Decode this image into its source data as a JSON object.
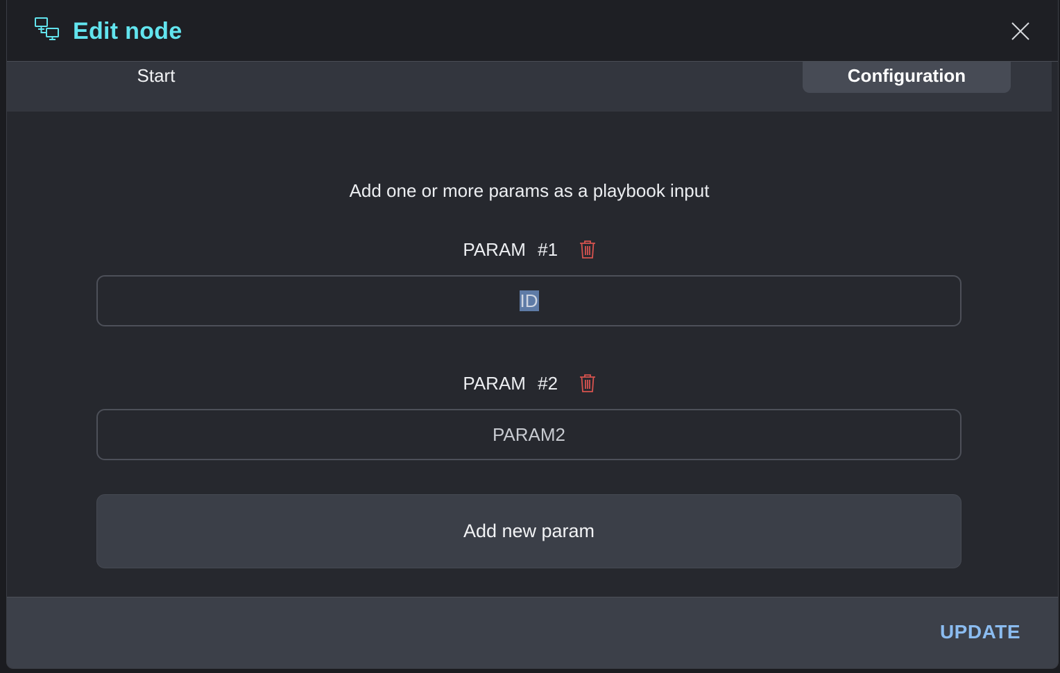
{
  "modal": {
    "title": "Edit node",
    "title_icon": "network-monitors-icon",
    "close_icon": "close-icon",
    "accent_color": "#62e4ee"
  },
  "tabs": [
    {
      "label": "Start",
      "active": false
    },
    {
      "label": "Configuration",
      "active": true
    }
  ],
  "content": {
    "description": "Add one or more params as a playbook input",
    "params": [
      {
        "label": "PARAM  #1",
        "value": "ID",
        "selected": true
      },
      {
        "label": "PARAM  #2",
        "value": "PARAM2",
        "selected": false
      }
    ],
    "delete_icon": "trash-icon",
    "delete_color": "#d9534f",
    "add_button_label": "Add new param"
  },
  "footer": {
    "update_label": "UPDATE",
    "update_color": "#8bbcf0"
  }
}
